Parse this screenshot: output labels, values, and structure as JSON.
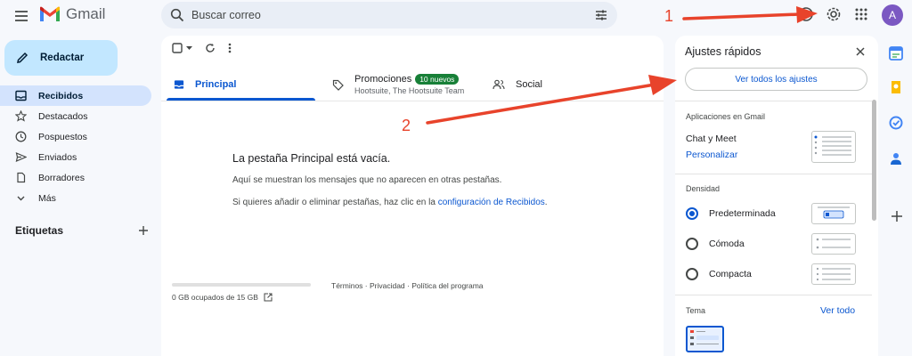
{
  "header": {
    "app_name": "Gmail",
    "search_placeholder": "Buscar correo",
    "avatar_letter": "A"
  },
  "sidebar": {
    "compose_label": "Redactar",
    "items": [
      {
        "label": "Recibidos",
        "icon": "inbox-icon",
        "active": true
      },
      {
        "label": "Destacados",
        "icon": "star-icon"
      },
      {
        "label": "Pospuestos",
        "icon": "clock-icon"
      },
      {
        "label": "Enviados",
        "icon": "send-icon"
      },
      {
        "label": "Borradores",
        "icon": "draft-icon"
      },
      {
        "label": "Más",
        "icon": "chevron-down-icon"
      }
    ],
    "labels_title": "Etiquetas"
  },
  "tabs": [
    {
      "label": "Principal",
      "icon": "inbox-icon",
      "active": true
    },
    {
      "label": "Promociones",
      "badge": "10 nuevos",
      "subtitle": "Hootsuite, The Hootsuite Team",
      "icon": "tag-icon"
    },
    {
      "label": "Social",
      "icon": "people-icon"
    }
  ],
  "empty_state": {
    "title": "La pestaña Principal está vacía.",
    "line1": "Aquí se muestran los mensajes que no aparecen en otras pestañas.",
    "line2_prefix": "Si quieres añadir o eliminar pestañas, haz clic en la ",
    "line2_link": "configuración de Recibidos",
    "line2_suffix": "."
  },
  "footer": {
    "storage": "0 GB ocupados de 15 GB",
    "storage_used_fraction": 0,
    "links": "Términos · Privacidad · Política del programa"
  },
  "quick_settings": {
    "title": "Ajustes rápidos",
    "see_all": "Ver todos los ajustes",
    "apps_section": "Aplicaciones en Gmail",
    "chat_meet": "Chat y Meet",
    "customize": "Personalizar",
    "density_section": "Densidad",
    "density_options": [
      {
        "label": "Predeterminada",
        "selected": true
      },
      {
        "label": "Cómoda",
        "selected": false
      },
      {
        "label": "Compacta",
        "selected": false
      }
    ],
    "theme_section": "Tema",
    "see_all_themes": "Ver todo"
  },
  "annotations": {
    "label1": "1",
    "label2": "2",
    "color": "#e8432b"
  },
  "colors": {
    "accent": "#0b57d0",
    "compose_bg": "#c2e7ff",
    "active_nav_bg": "#d3e3fd",
    "badge_green": "#188038"
  }
}
